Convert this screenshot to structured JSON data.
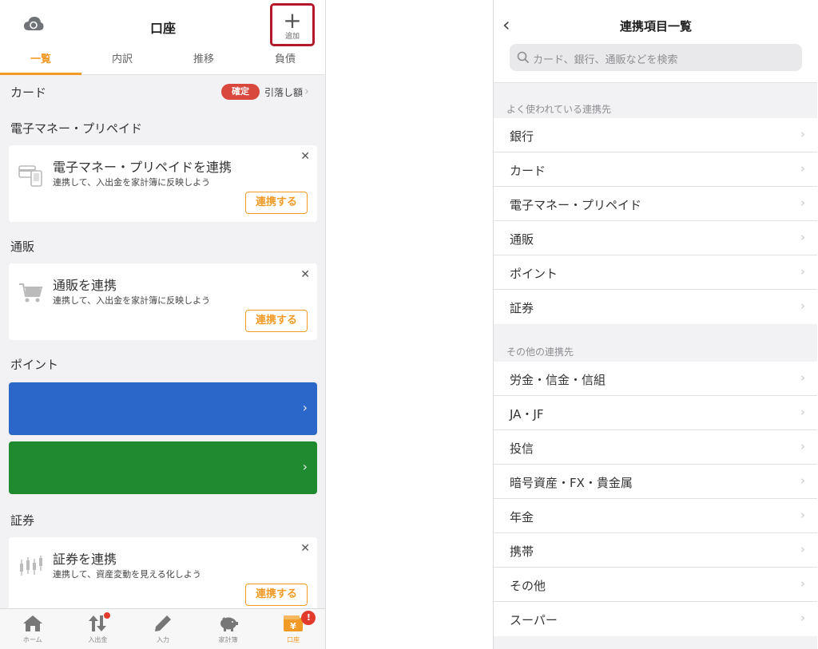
{
  "left": {
    "header": {
      "title": "口座",
      "add_label": "追加",
      "add_symbol": "+"
    },
    "tabs": [
      {
        "label": "一覧",
        "active": true
      },
      {
        "label": "内訳",
        "active": false
      },
      {
        "label": "推移",
        "active": false
      },
      {
        "label": "負債",
        "active": false
      }
    ],
    "card_section": {
      "title": "カード",
      "badge": "確定",
      "link": "引落し額"
    },
    "emoney_section": {
      "title": "電子マネー・プリペイド",
      "panel": {
        "title": "電子マネー・プリペイドを連携",
        "subtitle": "連携して、入出金を家計簿に反映しよう",
        "button": "連携する",
        "close": "✕"
      }
    },
    "ec_section": {
      "title": "通販",
      "panel": {
        "title": "通販を連携",
        "subtitle": "連携して、入出金を家計簿に反映しよう",
        "button": "連携する",
        "close": "✕"
      }
    },
    "point_section": {
      "title": "ポイント",
      "bar1_color": "#2b67c9",
      "bar2_color": "#1f8a2f"
    },
    "securities_section": {
      "title": "証券",
      "panel": {
        "title": "証券を連携",
        "subtitle": "連携して、資産変動を見える化しよう",
        "button": "連携する",
        "close": "✕"
      }
    },
    "bottom_nav": [
      {
        "label": "ホーム",
        "icon": "home-icon"
      },
      {
        "label": "入出金",
        "icon": "transfer-icon"
      },
      {
        "label": "入力",
        "icon": "pencil-icon"
      },
      {
        "label": "家計簿",
        "icon": "piggy-bank-icon"
      },
      {
        "label": "口座",
        "icon": "wallet-icon",
        "active": true,
        "badge": "!"
      }
    ],
    "accent_color": "#f29a26"
  },
  "right": {
    "header": {
      "title": "連携項目一覧",
      "search_placeholder": "カード、銀行、通販などを検索"
    },
    "frequent_header": "よく使われている連携先",
    "frequent": [
      "銀行",
      "カード",
      "電子マネー・プリペイド",
      "通販",
      "ポイント",
      "証券"
    ],
    "other_header": "その他の連携先",
    "other": [
      "労金・信金・信組",
      "JA・JF",
      "投信",
      "暗号資産・FX・貴金属",
      "年金",
      "携帯",
      "その他",
      "スーパー"
    ]
  }
}
